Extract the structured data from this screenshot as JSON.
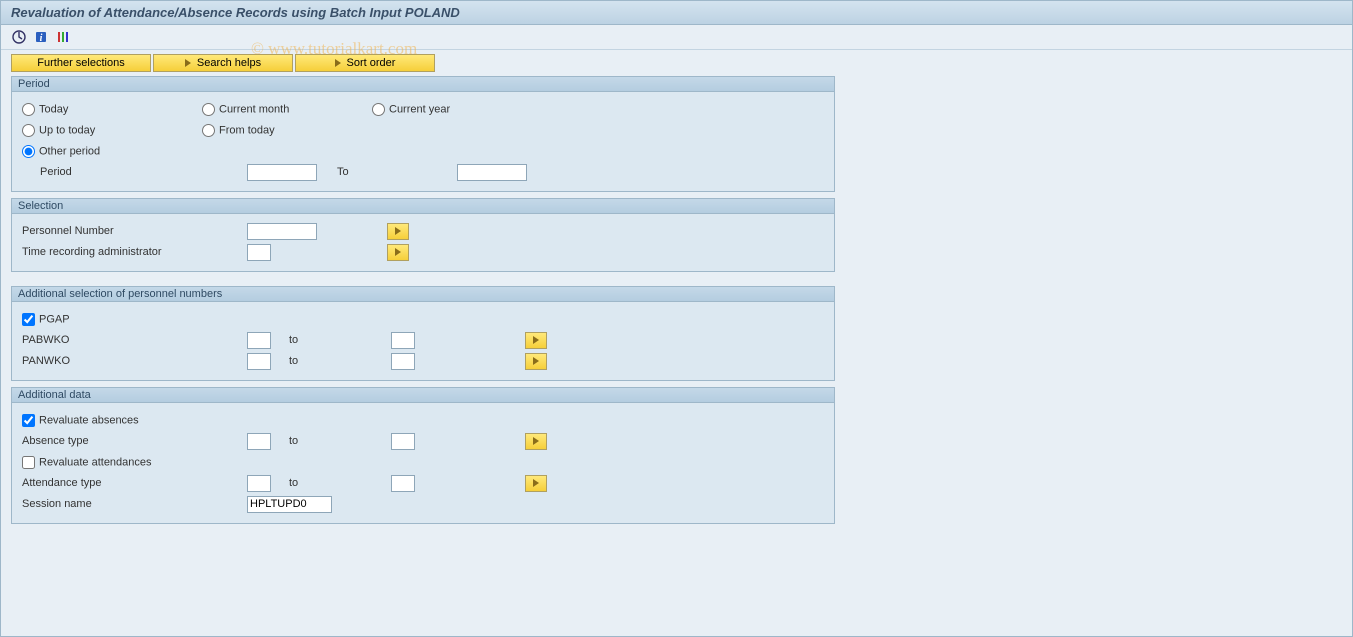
{
  "title": "Revaluation of Attendance/Absence Records using Batch Input POLAND",
  "watermark": "© www.tutorialkart.com",
  "toolbar_icons": {
    "execute": "execute-icon",
    "info": "info-icon",
    "variant": "variant-icon"
  },
  "buttons": {
    "further": "Further selections",
    "search": "Search helps",
    "sort": "Sort order"
  },
  "group_period": {
    "title": "Period",
    "today": "Today",
    "current_month": "Current month",
    "current_year": "Current year",
    "up_to_today": "Up to today",
    "from_today": "From today",
    "other_period": "Other period",
    "period_label": "Period",
    "to_label": "To",
    "period_from": "",
    "period_to": ""
  },
  "group_selection": {
    "title": "Selection",
    "pernr_label": "Personnel Number",
    "pernr_value": "",
    "timeadmin_label": "Time recording administrator",
    "timeadmin_value": ""
  },
  "group_addsel": {
    "title": "Additional selection of personnel numbers",
    "pgap_label": "PGAP",
    "pgap_checked": true,
    "pabwko_label": "PABWKO",
    "pabwko_from": "",
    "pabwko_to": "",
    "panwko_label": "PANWKO",
    "panwko_from": "",
    "panwko_to": "",
    "to_label": "to"
  },
  "group_adddata": {
    "title": "Additional data",
    "reval_abs_label": "Revaluate absences",
    "reval_abs_checked": true,
    "abs_type_label": "Absence type",
    "abs_type_from": "",
    "abs_type_to": "",
    "reval_att_label": "Revaluate attendances",
    "reval_att_checked": false,
    "att_type_label": "Attendance type",
    "att_type_from": "",
    "att_type_to": "",
    "session_label": "Session name",
    "session_value": "HPLTUPD0",
    "to_label": "to"
  }
}
